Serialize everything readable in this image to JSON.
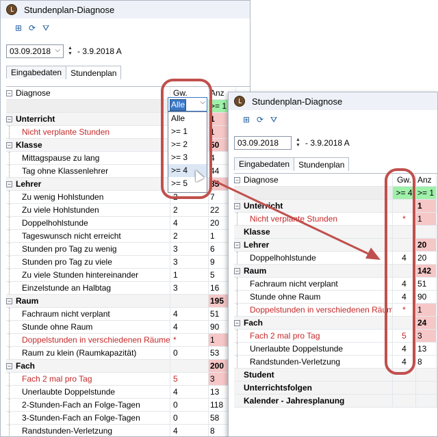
{
  "back_window": {
    "title": "Stundenplan-Diagnose",
    "date_value": "03.09.2018",
    "date_range_suffix": "- 3.9.2018 A",
    "tabs": [
      {
        "label": "Eingabedaten"
      },
      {
        "label": "Stundenplan"
      }
    ],
    "header": {
      "diagnose": "Diagnose",
      "gw": "Gw.",
      "anz": "Anz"
    },
    "filter_row": {
      "gw_combo_value": "Alle",
      "anz_filter": ">= 1"
    },
    "dropdown_options": [
      "Alle",
      ">= 1",
      ">= 2",
      ">= 3",
      ">= 4",
      ">= 5"
    ],
    "rows": [
      {
        "label": "Unterricht",
        "group": true,
        "gw": "",
        "anz": "1"
      },
      {
        "label": "Nicht verplante Stunden",
        "red": true,
        "gw": "",
        "anz": "1"
      },
      {
        "label": "Klasse",
        "group": true,
        "gw": "",
        "anz": "50"
      },
      {
        "label": "Mittagspause zu lang",
        "gw": "",
        "anz": "4"
      },
      {
        "label": "Tag ohne Klassenlehrer",
        "gw": "",
        "anz": "44"
      },
      {
        "label": "Lehrer",
        "group": true,
        "gw": "",
        "anz": "85"
      },
      {
        "label": "Zu wenig Hohlstunden",
        "gw": "2",
        "anz": "7"
      },
      {
        "label": "Zu viele Hohlstunden",
        "gw": "2",
        "anz": "22"
      },
      {
        "label": "Doppelhohlstunde",
        "gw": "4",
        "anz": "20"
      },
      {
        "label": "Tageswunsch nicht erreicht",
        "gw": "2",
        "anz": "1"
      },
      {
        "label": "Stunden pro Tag zu wenig",
        "gw": "3",
        "anz": "6"
      },
      {
        "label": "Stunden pro Tag zu viele",
        "gw": "3",
        "anz": "9"
      },
      {
        "label": "Zu viele Stunden hintereinander",
        "gw": "1",
        "anz": "5"
      },
      {
        "label": "Einzelstunde an Halbtag",
        "gw": "3",
        "anz": "16"
      },
      {
        "label": "Raum",
        "group": true,
        "gw": "",
        "anz": "195"
      },
      {
        "label": "Fachraum nicht verplant",
        "gw": "4",
        "anz": "51"
      },
      {
        "label": "Stunde ohne Raum",
        "gw": "4",
        "anz": "90"
      },
      {
        "label": "Doppelstunden in verschiedenen Räumen",
        "red": true,
        "gw": "*",
        "anz": "1"
      },
      {
        "label": "Raum zu klein (Raumkapazität)",
        "gw": "0",
        "anz": "53"
      },
      {
        "label": "Fach",
        "group": true,
        "gw": "",
        "anz": "200"
      },
      {
        "label": "Fach 2 mal pro Tag",
        "red": true,
        "gw": "5",
        "anz": "3"
      },
      {
        "label": "Unerlaubte Doppelstunde",
        "gw": "4",
        "anz": "13"
      },
      {
        "label": "2-Stunden-Fach an Folge-Tagen",
        "gw": "0",
        "anz": "118"
      },
      {
        "label": "3-Stunden-Fach an Folge-Tagen",
        "gw": "0",
        "anz": "58"
      },
      {
        "label": "Randstunden-Verletzung",
        "gw": "4",
        "anz": "8"
      }
    ]
  },
  "front_window": {
    "title": "Stundenplan-Diagnose",
    "date_value": "03.09.2018",
    "date_range_suffix": "- 3.9.2018 A",
    "tabs": [
      {
        "label": "Eingabedaten"
      },
      {
        "label": "Stundenplan"
      }
    ],
    "header": {
      "diagnose": "Diagnose",
      "gw": "Gw.",
      "anz": "Anz"
    },
    "filter_row": {
      "gw_filter": ">= 4",
      "anz_filter": ">= 1"
    },
    "rows": [
      {
        "label": "Unterricht",
        "group": true,
        "gw": "",
        "anz": "1"
      },
      {
        "label": "Nicht verplante Stunden",
        "red": true,
        "gw": "*",
        "anz": "1"
      },
      {
        "label": "Klasse",
        "group": true,
        "nopm": true,
        "gw": "",
        "anz": ""
      },
      {
        "label": "Lehrer",
        "group": true,
        "gw": "",
        "anz": "20"
      },
      {
        "label": "Doppelhohlstunde",
        "gw": "4",
        "anz": "20"
      },
      {
        "label": "Raum",
        "group": true,
        "gw": "",
        "anz": "142"
      },
      {
        "label": "Fachraum nicht verplant",
        "gw": "4",
        "anz": "51"
      },
      {
        "label": "Stunde ohne Raum",
        "gw": "4",
        "anz": "90"
      },
      {
        "label": "Doppelstunden in verschiedenen Räumen",
        "red": true,
        "gw": "*",
        "anz": "1"
      },
      {
        "label": "Fach",
        "group": true,
        "gw": "",
        "anz": "24"
      },
      {
        "label": "Fach 2 mal pro Tag",
        "red": true,
        "gw": "5",
        "anz": "3"
      },
      {
        "label": "Unerlaubte Doppelstunde",
        "gw": "4",
        "anz": "13"
      },
      {
        "label": "Randstunden-Verletzung",
        "gw": "4",
        "anz": "8"
      },
      {
        "label": "Student",
        "group": true,
        "nopm": true,
        "gw": "",
        "anz": ""
      },
      {
        "label": "Unterrichtsfolgen",
        "group": true,
        "nopm": true,
        "gw": "",
        "anz": ""
      },
      {
        "label": "Kalender - Jahresplanung",
        "group": true,
        "nopm": true,
        "gw": "",
        "anz": ""
      }
    ]
  },
  "colors": {
    "highlight_ring": "#c0504d",
    "pink": "#f6c7c7",
    "green": "#9ff0a9",
    "error_text": "#c62828"
  }
}
